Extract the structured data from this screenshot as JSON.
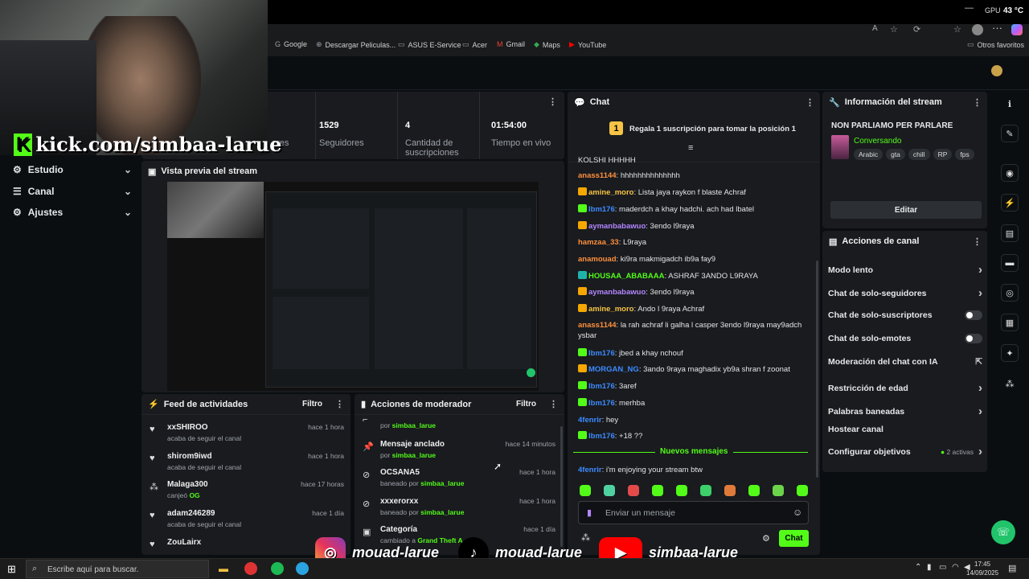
{
  "browser": {
    "gpu_label": "GPU",
    "gpu_temp": "43 °C",
    "bookmarks": [
      "Google",
      "Descargar Peliculas...",
      "ASUS E-Service",
      "Acer",
      "Gmail",
      "Maps",
      "YouTube"
    ],
    "other_favorites": "Otros favoritos"
  },
  "overlay": {
    "kick_url": "kick.com/simbaa-larue",
    "instagram": "mouad-larue",
    "tiktok": "mouad-larue",
    "youtube": "simbaa-larue"
  },
  "sidebar": {
    "items": [
      {
        "label": "Estudio"
      },
      {
        "label": "Canal"
      },
      {
        "label": "Ajustes"
      }
    ]
  },
  "stats": {
    "partial_label": "ores",
    "followers_value": "1529",
    "followers_label": "Seguidores",
    "subs_value": "4",
    "subs_label": "Cantidad de suscripciones",
    "time_value": "01:54:00",
    "time_label": "Tiempo en vivo"
  },
  "preview": {
    "title": "Vista previa del stream"
  },
  "activity": {
    "title": "Feed de actividades",
    "filter": "Filtro",
    "items": [
      {
        "name": "xxSHIROO",
        "sub": "acaba de seguir el canal",
        "time": "hace 1 hora"
      },
      {
        "name": "shirom9iwd",
        "sub": "acaba de seguir el canal",
        "time": "hace 1 hora"
      },
      {
        "name": "Malaga300",
        "sub": "canjeó",
        "sub_hl": "OG",
        "time": "hace 17 horas"
      },
      {
        "name": "adam246289",
        "sub": "acaba de seguir el canal",
        "time": "hace 1 día"
      },
      {
        "name": "ZouLairx",
        "sub": "",
        "time": ""
      }
    ]
  },
  "moderator": {
    "title": "Acciones de moderador",
    "filter": "Filtro",
    "by": "por",
    "mod": "simbaa_larue",
    "items": [
      {
        "name": "",
        "sub": "por",
        "time": ""
      },
      {
        "name": "Mensaje anclado",
        "sub": "por",
        "time": "hace 14 minutos"
      },
      {
        "name": "OCSANA5",
        "sub": "baneado por",
        "time": "hace 1 hora"
      },
      {
        "name": "xxxerorxx",
        "sub": "baneado por",
        "time": "hace 1 hora"
      },
      {
        "name": "Categoría",
        "sub": "cambiado a",
        "game": "Grand Theft A",
        "game_end": "TA)",
        "sub2": "por",
        "time": "hace 1 día"
      }
    ]
  },
  "chat": {
    "title": "Chat",
    "gift_rank": "1",
    "gift_text": "Regala 1 suscripción para tomar la posición 1",
    "new_messages": "Nuevos mensajes",
    "input_placeholder": "Enviar un mensaje",
    "send": "Chat",
    "messages": [
      {
        "user": "",
        "text": "KOLSHI HHHHH",
        "color": "#e4e4e4",
        "badge": ""
      },
      {
        "user": "anass1144",
        "text": ": hhhhhhhhhhhhhh",
        "color": "#ff8f3c",
        "badge": ""
      },
      {
        "user": "amine_moro",
        "text": ": Lista jaya raykon f blaste Achraf",
        "color": "#f6c445",
        "badge": "#f6a700"
      },
      {
        "user": "lbm176",
        "text": ": maderdch a khay hadchi. ach had lbatel",
        "color": "#3d8bff",
        "badge": "#53fc18"
      },
      {
        "user": "aymanbabawuo",
        "text": ": 3endo l9raya",
        "color": "#b486ff",
        "badge": "#f6a700"
      },
      {
        "user": "hamzaa_33",
        "text": ": L9raya",
        "color": "#ff8f3c",
        "badge": ""
      },
      {
        "user": "anamouad",
        "text": ": ki9ra makmigadch ib9a fay9",
        "color": "#ff8f3c",
        "badge": ""
      },
      {
        "user": "HOUSAA_ABABAAA",
        "text": ": ASHRAF 3ANDO L9RAYA",
        "color": "#53fc18",
        "badge": "#20b2aa"
      },
      {
        "user": "aymanbabawuo",
        "text": ": 3endo l9raya",
        "color": "#b486ff",
        "badge": "#f6a700"
      },
      {
        "user": "amine_moro",
        "text": ": Ando l 9raya Achraf",
        "color": "#f6c445",
        "badge": "#f6a700"
      },
      {
        "user": "anass1144",
        "text": ": la rah achraf li galha l casper 3endo l9raya may9adch ysbar",
        "color": "#ff8f3c",
        "badge": ""
      },
      {
        "user": "lbm176",
        "text": ": jbed a khay nchouf",
        "color": "#3d8bff",
        "badge": "#53fc18"
      },
      {
        "user": "MORGAN_NG",
        "text": ": 3ando 9raya maghadix yb9a shran f zoonat",
        "color": "#3d8bff",
        "badge": "#f6a700"
      },
      {
        "user": "lbm176",
        "text": ": 3aref",
        "color": "#3d8bff",
        "badge": "#53fc18"
      },
      {
        "user": "lbm176",
        "text": ": merhba",
        "color": "#3d8bff",
        "badge": "#53fc18"
      },
      {
        "user": "4fenrir",
        "text": ": hey",
        "color": "#3d8bff",
        "badge": ""
      },
      {
        "user": "lbm176",
        "text": ": +18 ??",
        "color": "#3d8bff",
        "badge": "#53fc18"
      },
      {
        "user": "4fenrir",
        "text": ": i'm enjoying your stream btw",
        "color": "#3d8bff",
        "badge": ""
      }
    ]
  },
  "stream_info": {
    "title": "Información del stream",
    "stream_title": "NON PARLIAMO PER PARLARE",
    "category": "Conversando",
    "tags": [
      "Arabic",
      "gta",
      "chill",
      "RP",
      "fps"
    ],
    "edit": "Editar"
  },
  "channel_actions": {
    "title": "Acciones de canal",
    "items": [
      {
        "label": "Modo lento",
        "ctl": "chev"
      },
      {
        "label": "Chat de solo-seguidores",
        "ctl": "chev"
      },
      {
        "label": "Chat de solo-suscriptores",
        "ctl": "toggle"
      },
      {
        "label": "Chat de solo-emotes",
        "ctl": "toggle"
      },
      {
        "label": "Moderación del chat con IA",
        "ctl": "ext"
      },
      {
        "label": "Restricción de edad",
        "ctl": "chev"
      },
      {
        "label": "Palabras baneadas",
        "ctl": "chev"
      },
      {
        "label": "Hostear canal",
        "ctl": ""
      },
      {
        "label": "Configurar objetivos",
        "ctl": "chev",
        "extra": "2 activas"
      }
    ]
  },
  "taskbar": {
    "search": "Escribe aquí para buscar.",
    "time": "17:45",
    "date": "14/09/2025"
  },
  "colors": {
    "accent": "#53fc18",
    "panel": "#191b1f",
    "background": "#0b0e11"
  }
}
